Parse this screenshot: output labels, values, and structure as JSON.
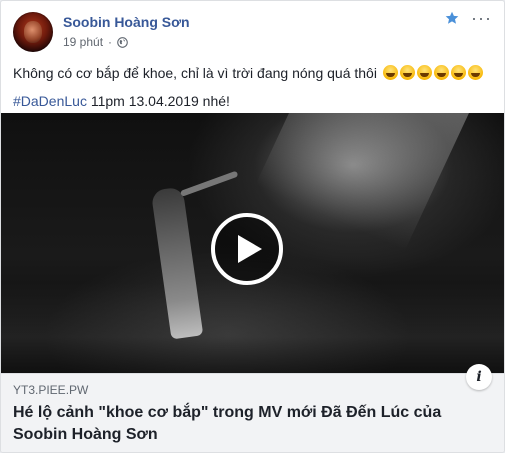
{
  "post": {
    "author": "Soobin Hoàng Sơn",
    "time": "19 phút",
    "privacy_icon": "globe-icon",
    "text_line1": "Không có cơ bắp để khoe, chỉ là vì trời đang nóng quá thôi",
    "emojis": [
      "laughing-emoji",
      "laughing-emoji",
      "laughing-emoji",
      "rofl-emoji",
      "rofl-emoji",
      "rofl-emoji"
    ],
    "hashtag": "#DaDenLuc",
    "text_line2_rest": "11pm 13.04.2019 nhé!"
  },
  "header_actions": {
    "star_icon": "star-icon",
    "more_label": "···"
  },
  "link": {
    "domain": "YT3.PIEE.PW",
    "title": "Hé lộ cảnh \"khoe cơ bắp\" trong MV mới Đã Đến Lúc của Soobin Hoàng Sơn",
    "info_label": "i"
  },
  "colors": {
    "link_blue": "#385898",
    "text": "#1d2129",
    "meta_gray": "#616770",
    "card_bg": "#ffffff",
    "link_bg": "#f2f3f5"
  }
}
